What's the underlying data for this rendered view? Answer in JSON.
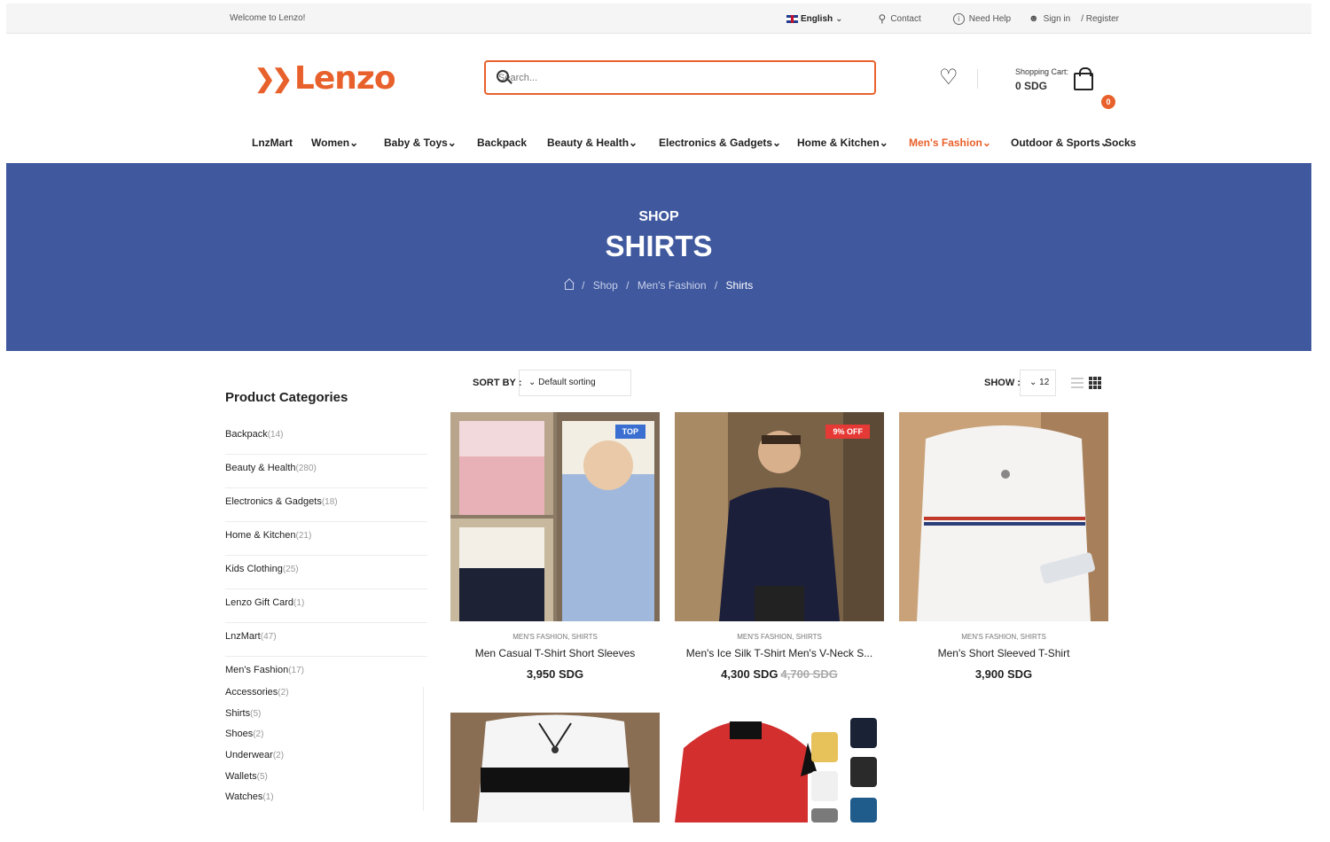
{
  "topbar": {
    "welcome": "Welcome to Lenzo!",
    "language": "English",
    "contact": "Contact",
    "help": "Need Help",
    "signin": "Sign in",
    "register": "/ Register"
  },
  "header": {
    "logo_text": "Lenzo",
    "search_placeholder": "Search...",
    "cart_label": "Shopping Cart:",
    "cart_amount": "0 SDG",
    "cart_count": "0"
  },
  "nav": [
    "LnzMart",
    "Women",
    "Baby & Toys",
    "Backpack",
    "Beauty & Health",
    "Electronics & Gadgets",
    "Home & Kitchen",
    "Men's Fashion",
    "Outdoor & Sports",
    "Socks"
  ],
  "hero": {
    "subtitle": "SHOP",
    "title": "SHIRTS",
    "crumbs": [
      "Shop",
      "Men's Fashion",
      "Shirts"
    ]
  },
  "sidebar": {
    "title": "Product Categories",
    "categories": [
      {
        "name": "Backpack",
        "count": "(14)"
      },
      {
        "name": "Beauty & Health",
        "count": "(280)"
      },
      {
        "name": "Electronics & Gadgets",
        "count": "(18)"
      },
      {
        "name": "Home & Kitchen",
        "count": "(21)"
      },
      {
        "name": "Kids Clothing",
        "count": "(25)"
      },
      {
        "name": "Lenzo Gift Card",
        "count": "(1)"
      },
      {
        "name": "LnzMart",
        "count": "(47)"
      },
      {
        "name": "Men's Fashion",
        "count": "(17)"
      }
    ],
    "subcategories": [
      {
        "name": "Accessories",
        "count": "(2)"
      },
      {
        "name": "Shirts",
        "count": "(5)"
      },
      {
        "name": "Shoes",
        "count": "(2)"
      },
      {
        "name": "Underwear",
        "count": "(2)"
      },
      {
        "name": "Wallets",
        "count": "(5)"
      },
      {
        "name": "Watches",
        "count": "(1)"
      }
    ]
  },
  "toolbar": {
    "sort_label": "SORT BY :",
    "sort_value": "Default sorting",
    "show_label": "SHOW :",
    "show_value": "12"
  },
  "products": [
    {
      "categories": "MEN'S FASHION, SHIRTS",
      "name": "Men Casual T-Shirt Short Sleeves",
      "price": "3,950 SDG",
      "old_price": "",
      "tag": "TOP",
      "tag_color": "#3a6fd1"
    },
    {
      "categories": "MEN'S FASHION, SHIRTS",
      "name": "Men's Ice Silk T-Shirt Men's V-Neck S...",
      "price": "4,300 SDG",
      "old_price": "4,700 SDG",
      "tag": "9% OFF",
      "tag_color": "#e53935"
    },
    {
      "categories": "MEN'S FASHION, SHIRTS",
      "name": "Men's Short Sleeved T-Shirt",
      "price": "3,900 SDG",
      "old_price": "",
      "tag": "",
      "tag_color": ""
    }
  ],
  "colors": {
    "accent": "#e8612c",
    "hero": "#3f589e"
  }
}
